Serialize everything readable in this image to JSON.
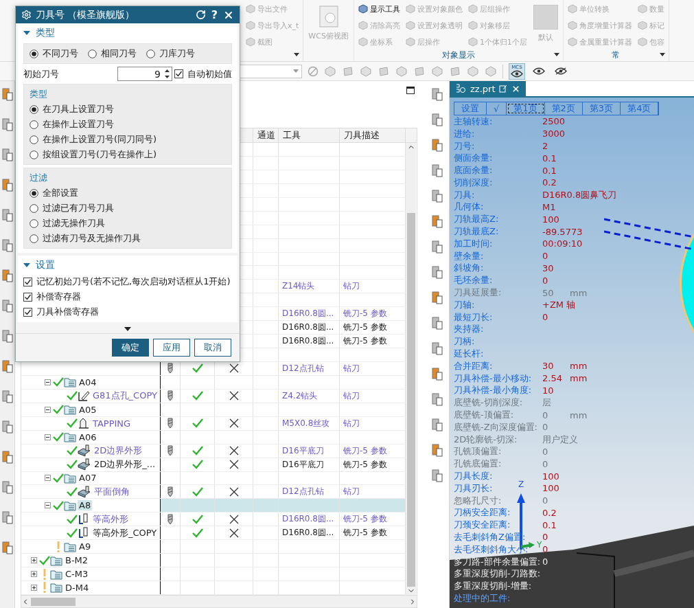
{
  "ribbon": {
    "groups": [
      {
        "kind": "list",
        "columns": [
          [
            {
              "label": "导出文件",
              "disabled": true
            },
            {
              "label": "导出导入x_t",
              "disabled": true
            },
            {
              "label": "截图",
              "disabled": true
            }
          ]
        ]
      },
      {
        "kind": "large",
        "item": {
          "label": "WCS俯视图",
          "disabled": true
        }
      },
      {
        "kind": "list",
        "label": "对象显示",
        "columns": [
          [
            {
              "label": "显示工具",
              "disabled": false
            },
            {
              "label": "清除高亮",
              "disabled": true
            },
            {
              "label": "坐标系",
              "disabled": true
            }
          ],
          [
            {
              "label": "设置对象颜色",
              "disabled": true
            },
            {
              "label": "设置对象透明",
              "disabled": true
            },
            {
              "label": "层操作",
              "disabled": true
            }
          ],
          [
            {
              "label": "层组操作",
              "disabled": true
            },
            {
              "label": "对象移层",
              "disabled": true
            },
            {
              "label": "1个体归1个层",
              "disabled": true
            }
          ]
        ],
        "dropdown": {
          "label": "默认",
          "disabled": true
        }
      },
      {
        "kind": "list",
        "label": "常",
        "columns": [
          [
            {
              "label": "单位转换",
              "disabled": true
            },
            {
              "label": "角度增量计算器",
              "disabled": true
            },
            {
              "label": "金属重量计算器",
              "disabled": true
            }
          ],
          [
            {
              "label": "数量",
              "disabled": true
            },
            {
              "label": "标记",
              "disabled": true
            },
            {
              "label": "包容",
              "disabled": true
            }
          ]
        ]
      }
    ]
  },
  "toolbar": {
    "view_buttons": [
      {
        "label": "MCS",
        "selected": true
      },
      {
        "selected": false
      },
      {
        "selected": false
      }
    ]
  },
  "dialog": {
    "title": "刀具号 （模圣旗舰版）",
    "help": "?",
    "type_section": {
      "title": "类型",
      "expanded": true,
      "modes": [
        {
          "label": "不同刀号",
          "selected": true
        },
        {
          "label": "相同刀号",
          "selected": false
        },
        {
          "label": "刀库刀号",
          "selected": false
        }
      ],
      "start_label": "初始刀号",
      "start_value": "9",
      "auto": {
        "label": "自动初始值",
        "checked": true
      },
      "groups": [
        {
          "title": "类型",
          "options": [
            {
              "label": "在刀具上设置刀号",
              "selected": true
            },
            {
              "label": "在操作上设置刀号",
              "selected": false
            },
            {
              "label": "在操作上设置刀号(同刀同号)",
              "selected": false
            },
            {
              "label": "按组设置刀号(刀号在操作上)",
              "selected": false
            }
          ]
        },
        {
          "title": "过滤",
          "options": [
            {
              "label": "全部设置",
              "selected": true
            },
            {
              "label": "过滤已有刀号刀具",
              "selected": false
            },
            {
              "label": "过滤无操作刀具",
              "selected": false
            },
            {
              "label": "过滤有刀号及无操作刀具",
              "selected": false
            }
          ]
        }
      ]
    },
    "settings_section": {
      "title": "设置",
      "expanded": true,
      "options": [
        {
          "label": "记忆初始刀号(若不记忆,每次启动对话框从1开始)",
          "checked": true
        },
        {
          "label": "补偿寄存器",
          "checked": true
        },
        {
          "label": "刀具补偿寄存器",
          "checked": true
        }
      ]
    },
    "buttons": [
      {
        "label": "确定",
        "kind": "primary"
      },
      {
        "label": "应用",
        "kind": "normal"
      },
      {
        "label": "取消",
        "kind": "normal"
      }
    ]
  },
  "navigator": {
    "columns": [
      "通道",
      "工具",
      "刀具描述"
    ],
    "tree": [
      {
        "kind": "blank",
        "selected": false,
        "children": [
          {
            "kind": "blank",
            "selected": false
          },
          {
            "kind": "blank",
            "selected": false
          },
          {
            "kind": "blank",
            "selected": false
          },
          {
            "kind": "blank",
            "selected": false
          },
          {
            "kind": "blank",
            "selected": false
          },
          {
            "kind": "blank",
            "selected": false
          },
          {
            "kind": "blank",
            "selected": false
          },
          {
            "kind": "blank",
            "selected": false
          },
          {
            "kind": "blank",
            "selected": false
          },
          {
            "kind": "blank",
            "selected": false,
            "linked": true,
            "tool": "Z14钻头",
            "description": "钻刀"
          },
          {
            "kind": "blank",
            "selected": false
          },
          {
            "kind": "blank",
            "selected": false,
            "linked": true,
            "tool": "D16R0.8圆...",
            "description": "铣刀-5 参数"
          },
          {
            "kind": "blank",
            "selected": false,
            "linked": false,
            "tool": "D16R0.8圆...",
            "description": "铣刀-5 参数"
          },
          {
            "kind": "blank",
            "selected": false,
            "linked": false,
            "tool": "D16R0.8圆...",
            "description": "铣刀-5 参数"
          },
          {
            "kind": "blank",
            "selected": false
          },
          {
            "kind": "blank",
            "selected": false,
            "linked": true,
            "has_tool": true,
            "generated": true,
            "crossed": true,
            "tool": "D12点孔钻",
            "description": "钻刀"
          },
          {
            "kind": "group",
            "name": "A04",
            "warning": false,
            "expanded": true,
            "selected": false,
            "children": [
              {
                "kind": "drill",
                "name": "G81点孔_COPY",
                "warning": false,
                "selected": false,
                "linked": true,
                "has_tool": true,
                "generated": true,
                "crossed": true,
                "tool": "Z4.2钻头",
                "description": "钻刀"
              }
            ]
          },
          {
            "kind": "group",
            "name": "A05",
            "warning": false,
            "expanded": true,
            "selected": false,
            "children": [
              {
                "kind": "tap",
                "name": "TAPPING",
                "warning": false,
                "selected": false,
                "linked": true,
                "has_tool": true,
                "generated": true,
                "crossed": true,
                "tool": "M5X0.8丝攻",
                "description": "钻刀"
              }
            ]
          },
          {
            "kind": "group",
            "name": "A06",
            "warning": false,
            "expanded": true,
            "selected": false,
            "children": [
              {
                "kind": "planar",
                "name": "2D边界外形",
                "warning": false,
                "selected": false,
                "linked": true,
                "has_tool": true,
                "generated": true,
                "crossed": true,
                "tool": "D16平底刀",
                "description": "铣刀-5 参数"
              },
              {
                "kind": "planar",
                "name": "2D边界外形_...",
                "warning": false,
                "selected": false,
                "linked": false,
                "has_tool": false,
                "generated": true,
                "crossed": true,
                "tool": "D16平底刀",
                "description": "铣刀-5 参数"
              }
            ]
          },
          {
            "kind": "group",
            "name": "A07",
            "warning": false,
            "expanded": true,
            "selected": false,
            "children": [
              {
                "kind": "planar",
                "name": "平面倒角",
                "warning": false,
                "selected": false,
                "linked": true,
                "has_tool": true,
                "generated": true,
                "crossed": true,
                "tool": "D12点孔钻",
                "description": "钻刀"
              }
            ]
          },
          {
            "kind": "group",
            "name": "A8",
            "warning": false,
            "expanded": true,
            "selected": true,
            "children": [
              {
                "kind": "zlevel",
                "name": "等高外形",
                "warning": false,
                "selected": false,
                "linked": true,
                "has_tool": true,
                "generated": true,
                "crossed": true,
                "tool": "D16R0.8圆...",
                "description": "铣刀-5 参数"
              },
              {
                "kind": "zlevel",
                "name": "等高外形_COPY",
                "warning": false,
                "selected": false,
                "linked": false,
                "has_tool": false,
                "generated": true,
                "crossed": true,
                "tool": "D16R0.8圆...",
                "description": "铣刀-5 参数"
              }
            ]
          },
          {
            "kind": "group",
            "name": "A9",
            "warning": true,
            "selected": false
          }
        ]
      },
      {
        "kind": "group",
        "name": "B-M2",
        "warning": false,
        "expanded": false,
        "selected": false
      },
      {
        "kind": "group",
        "name": "C-M3",
        "warning": true,
        "expanded": false,
        "selected": false
      },
      {
        "kind": "group",
        "name": "D-M4",
        "warning": true,
        "expanded": false,
        "selected": false
      }
    ]
  },
  "viewport": {
    "tab": "zz.prt",
    "pages": [
      {
        "label": "设置",
        "selected": false
      },
      {
        "label": "√",
        "selected": false
      },
      {
        "label": "第1页",
        "selected": true
      },
      {
        "label": "第2页",
        "selected": false
      },
      {
        "label": "第3页",
        "selected": false
      },
      {
        "label": "第4页",
        "selected": false
      }
    ],
    "info": [
      {
        "label": "主轴转速:",
        "value": "2500",
        "kind": "active"
      },
      {
        "label": "进给:",
        "value": "3000",
        "kind": "active"
      },
      {
        "label": "刀号:",
        "value": "2",
        "kind": "active"
      },
      {
        "label": "侧面余量:",
        "value": "0.1",
        "kind": "active"
      },
      {
        "label": "底面余量:",
        "value": "0.1",
        "kind": "active"
      },
      {
        "label": "切削深度:",
        "value": "0.2",
        "kind": "active"
      },
      {
        "label": "刀具:",
        "value": "D16R0.8圆鼻飞刀",
        "kind": "active"
      },
      {
        "label": "几何体:",
        "value": "M1",
        "kind": "active"
      },
      {
        "label": "刀轨最高Z:",
        "value": "100",
        "kind": "active"
      },
      {
        "label": "刀轨最底Z:",
        "value": "-89.5773",
        "kind": "active"
      },
      {
        "label": "加工时间:",
        "value": "00:09:10",
        "kind": "active"
      },
      {
        "label": "壁余量:",
        "value": "0",
        "kind": "active"
      },
      {
        "label": "斜坡角:",
        "value": "30",
        "kind": "active"
      },
      {
        "label": "毛坯余量:",
        "value": "0",
        "kind": "active"
      },
      {
        "label": "刀具延展量:",
        "value": "50",
        "unit": "mm",
        "kind": "disabled"
      },
      {
        "label": "刀轴:",
        "value": "+ZM 轴",
        "kind": "active"
      },
      {
        "label": "最短刀长:",
        "value": "0",
        "kind": "active"
      },
      {
        "label": "夹持器:",
        "kind": "active"
      },
      {
        "label": "刀柄:",
        "kind": "active"
      },
      {
        "label": "延长杆:",
        "kind": "active"
      },
      {
        "label": "合并距离:",
        "value": "30",
        "unit": "mm",
        "kind": "active"
      },
      {
        "label": "刀具补偿-最小移动:",
        "value": "2.54",
        "unit": "mm",
        "kind": "active"
      },
      {
        "label": "刀具补偿-最小角度:",
        "value": "10",
        "kind": "active"
      },
      {
        "label": "底壁铣-切削深度:",
        "value": "层",
        "kind": "disabled"
      },
      {
        "label": "底壁铣-顶偏置:",
        "value": "0",
        "unit": "mm",
        "kind": "disabled"
      },
      {
        "label": "底壁铣-Z向深度偏置:",
        "value": "0",
        "kind": "disabled"
      },
      {
        "label": "2D轮廓铣-切深:",
        "value": "用户定义",
        "kind": "disabled"
      },
      {
        "label": "孔铣顶偏置:",
        "value": "0",
        "kind": "disabled"
      },
      {
        "label": "孔铣底偏置:",
        "value": "0",
        "kind": "disabled"
      },
      {
        "label": "刀具长度:",
        "value": "100",
        "kind": "active"
      },
      {
        "label": "刀具刃长:",
        "value": "100",
        "kind": "active"
      },
      {
        "label": "忽略孔尺寸:",
        "value": "0",
        "kind": "disabled"
      },
      {
        "label": "刀柄安全距离:",
        "value": "0.2",
        "kind": "active"
      },
      {
        "label": "刀颈安全距离:",
        "value": "0.1",
        "kind": "active"
      },
      {
        "label": "去毛刺斜角Z偏置:",
        "value": "0",
        "kind": "active"
      },
      {
        "label": "去毛坯刺斜角大小:",
        "value": "0",
        "kind": "active"
      },
      {
        "label": "多刀路-部件余量偏置:",
        "value": "0",
        "kind": "dark"
      },
      {
        "label": "多重深度切削-刀路数:",
        "kind": "dark"
      },
      {
        "label": "多重深度切削-增量:",
        "kind": "dark"
      },
      {
        "label": "处理中的工件:",
        "kind": "accent"
      }
    ],
    "axes": [
      "Z",
      "Y"
    ]
  }
}
